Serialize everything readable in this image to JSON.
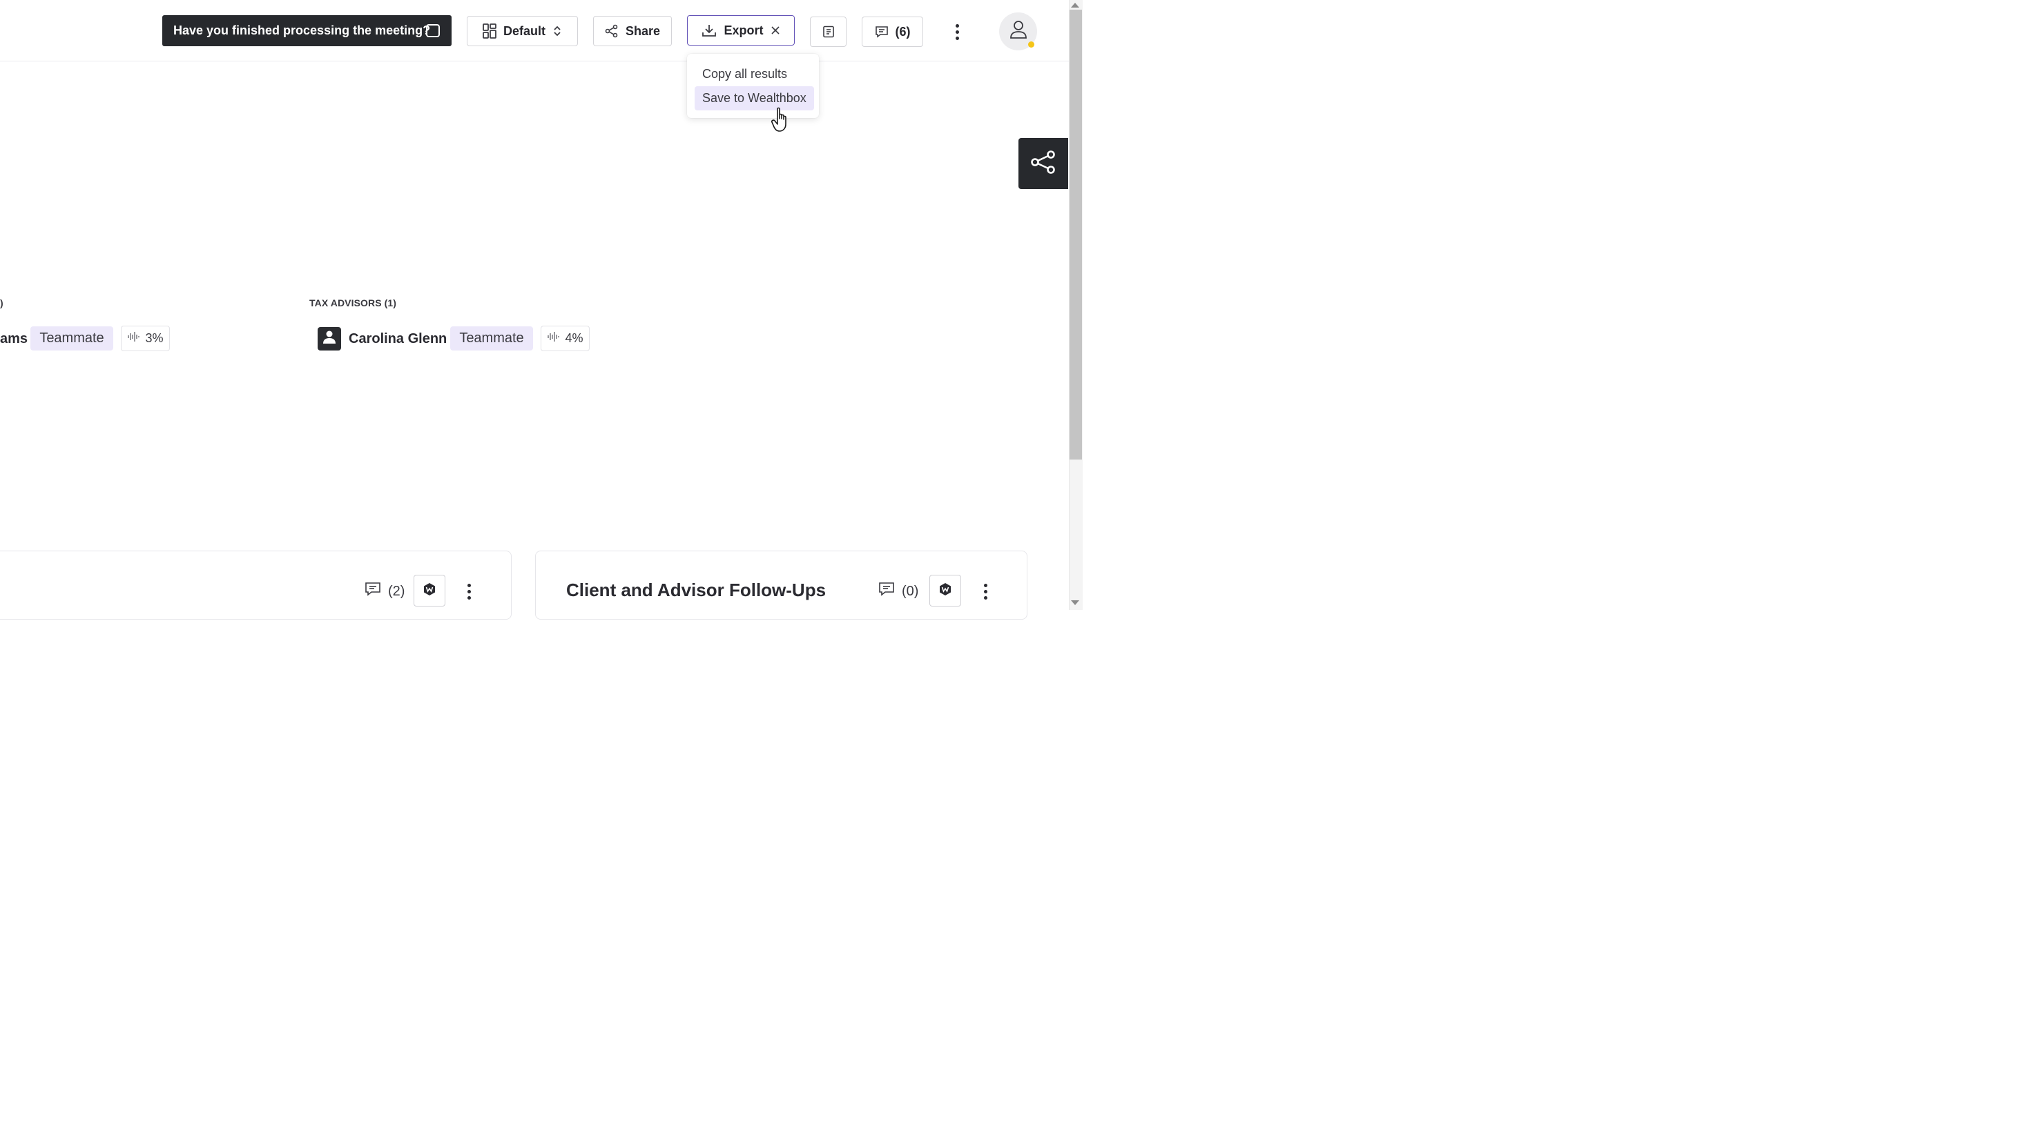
{
  "header": {
    "banner_text": "Have you finished processing the meeting?",
    "layout_label": "Default",
    "share_label": "Share",
    "export_label": "Export",
    "comments_count": "(6)"
  },
  "export_menu": {
    "items": [
      {
        "label": "Copy all results"
      },
      {
        "label": "Save to Wealthbox"
      }
    ],
    "active_index": 1
  },
  "participants": {
    "left_section_label": ")",
    "left_name_partial": "ams",
    "left_role": "Teammate",
    "left_talk_pct": "3%",
    "tax_section_label": "TAX ADVISORS (1)",
    "tax_person_name": "Carolina Glenn",
    "tax_person_role": "Teammate",
    "tax_talk_pct": "4%"
  },
  "cards": {
    "left_comments": "(2)",
    "right_title": "Client and Advisor Follow-Ups",
    "right_comments": "(0)"
  },
  "colors": {
    "dark": "#27292d",
    "accent": "#6554b8",
    "tag_bg": "#ece8fa",
    "status_dot": "#f5c518"
  }
}
